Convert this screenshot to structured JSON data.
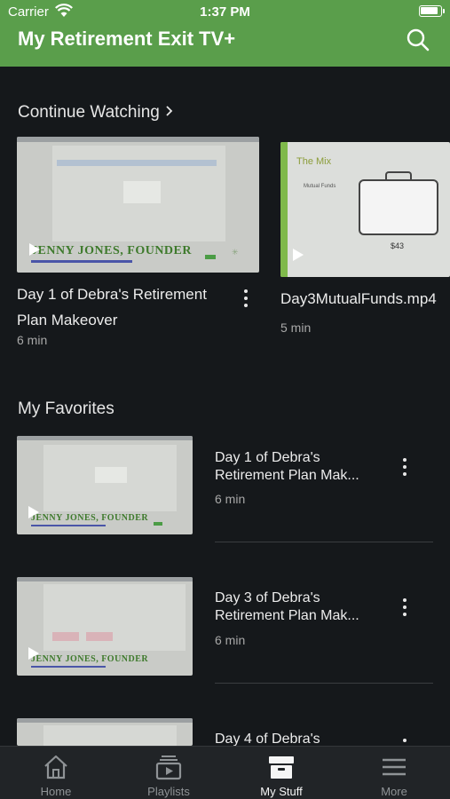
{
  "status": {
    "carrier": "Carrier",
    "time": "1:37 PM"
  },
  "header": {
    "title": "My Retirement Exit TV+",
    "search_icon": "search-icon"
  },
  "continue_watching": {
    "title": "Continue Watching",
    "items": [
      {
        "title_line1": "Day 1 of Debra's Retirement",
        "title_line2": "Plan Makeover",
        "duration": "6 min",
        "thumb_text": "JENNY JONES, FOUNDER"
      },
      {
        "title_line1": "Day3MutualFunds.mp4",
        "duration": "5 min",
        "thumb_heading": "The Mix",
        "thumb_bullet": "Mutual Funds",
        "thumb_price": "$43"
      }
    ]
  },
  "favorites": {
    "title": "My Favorites",
    "items": [
      {
        "title_line1": "Day 1 of Debra's",
        "title_line2": "Retirement Plan Mak...",
        "duration": "6 min",
        "thumb_text": "JENNY JONES, FOUNDER"
      },
      {
        "title_line1": "Day 3 of Debra's",
        "title_line2": "Retirement Plan Mak...",
        "duration": "6 min",
        "thumb_text": "JENNY JONES, FOUNDER"
      },
      {
        "title_line1": "Day 4 of Debra's"
      }
    ]
  },
  "tabbar": {
    "tabs": [
      {
        "label": "Home",
        "icon": "home-icon",
        "active": false
      },
      {
        "label": "Playlists",
        "icon": "playlists-icon",
        "active": false
      },
      {
        "label": "My Stuff",
        "icon": "archive-box-icon",
        "active": true
      },
      {
        "label": "More",
        "icon": "menu-icon",
        "active": false
      }
    ]
  },
  "colors": {
    "header_green": "#5a9e4b",
    "background": "#15181b",
    "tabbar": "#212427"
  }
}
